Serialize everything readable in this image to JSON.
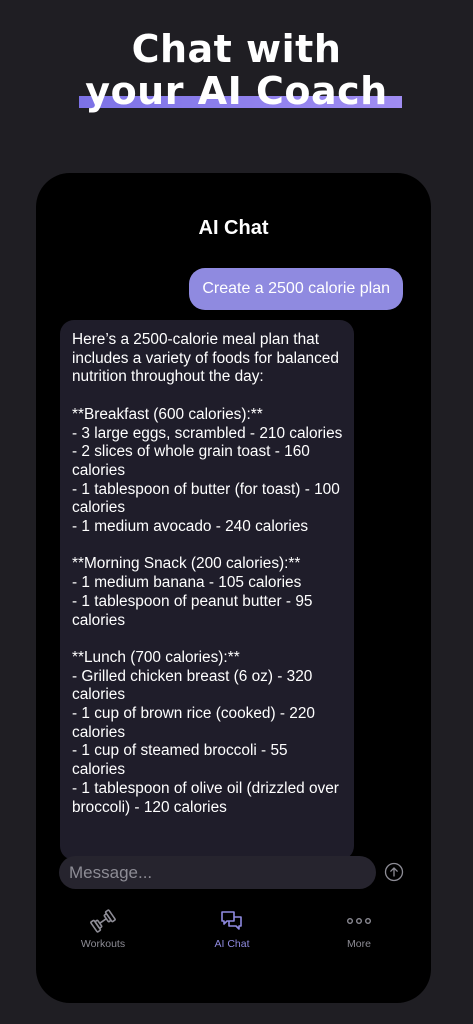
{
  "promo": {
    "line1": "Chat with",
    "line2": "your AI Coach"
  },
  "header": {
    "title": "AI Chat"
  },
  "messages": {
    "user": "Create a 2500 calorie plan",
    "assistant": "Here’s a 2500-calorie meal plan that includes a variety of foods for balanced nutrition throughout the day:\n\n**Breakfast (600 calories):**\n- 3 large eggs, scrambled - 210 calories\n- 2 slices of whole grain toast - 160 calories\n- 1 tablespoon of butter (for toast) - 100 calories\n- 1 medium avocado - 240 calories\n\n**Morning Snack (200 calories):**\n- 1 medium banana - 105 calories\n- 1 tablespoon of peanut butter - 95 calories\n\n**Lunch (700 calories):**\n- Grilled chicken breast (6 oz) - 320 calories\n- 1 cup of brown rice (cooked) - 220 calories\n- 1 cup of steamed broccoli - 55 calories\n- 1 tablespoon of olive oil (drizzled over broccoli) - 120 calories"
  },
  "composer": {
    "placeholder": "Message...",
    "send_icon": "send-arrow-up-icon"
  },
  "tabs": [
    {
      "label": "Workouts",
      "icon": "dumbbell-icon",
      "active": false
    },
    {
      "label": "AI Chat",
      "icon": "chat-bubbles-icon",
      "active": true
    },
    {
      "label": "More",
      "icon": "more-dots-icon",
      "active": false
    }
  ],
  "colors": {
    "accent": "#8f8ae0",
    "background": "#1f1e23",
    "screen": "#000000",
    "assistant_bubble": "#1f1d2a"
  }
}
